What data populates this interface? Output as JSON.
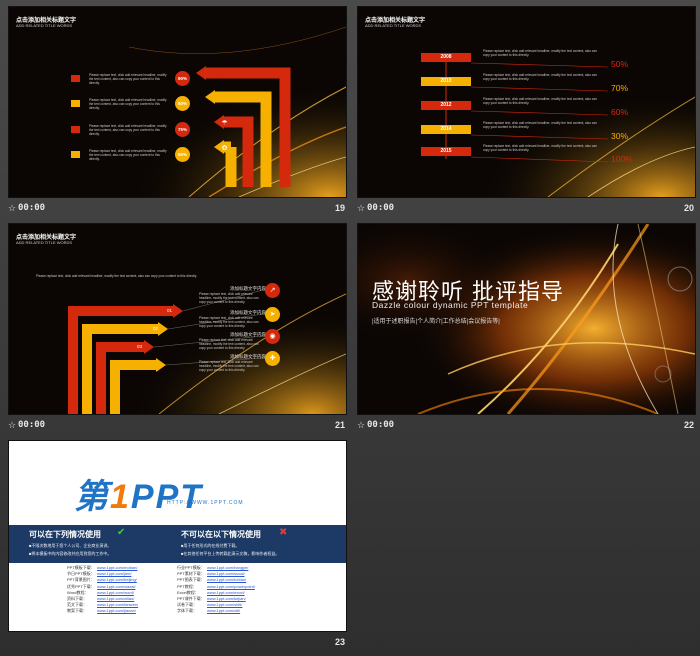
{
  "common": {
    "slide_title": "点击添加相关标题文字",
    "slide_subtitle": "ADD RELATED TITLE WORDS",
    "duration": "00:00",
    "star_icon": "☆",
    "placeholder_text": "Please replace text, click add relevant headline, modify the text content, also can copy your content to this directly."
  },
  "colors": {
    "red": "#d4290d",
    "yellow": "#f6b000"
  },
  "slides": [
    {
      "number": "19",
      "percents": [
        "90%",
        "60%",
        "75%",
        "65%"
      ]
    },
    {
      "number": "20",
      "timeline": [
        {
          "year": "2008",
          "percent": "50%"
        },
        {
          "year": "2010",
          "percent": "70%"
        },
        {
          "year": "2012",
          "percent": "60%"
        },
        {
          "year": "2014",
          "percent": "30%"
        },
        {
          "year": "2015",
          "percent": "100%"
        }
      ]
    },
    {
      "number": "21",
      "steps": [
        "01",
        "02",
        "03"
      ],
      "labels": [
        "添加标题文字内容",
        "添加标题文字内容",
        "添加标题文字内容",
        "添加标题文字内容"
      ]
    },
    {
      "number": "22",
      "title": "感谢聆听 批评指导",
      "subtitle_en": "Dazzle colour dynamic PPT template",
      "description": "|适用于述职报告|个人简介|工作总结|会议报告等|"
    },
    {
      "number": "23",
      "logo_main": "第",
      "logo_one": "1",
      "logo_rest": "PPT",
      "logo_url": "HTTP://WWW.1PPT.COM",
      "can_use_title": "可以在下列情况使用",
      "cannot_use_title": "不可以在以下情况使用",
      "can_use_items": [
        "■不限次数地用于您个人公司、企业商业演讲。",
        "■将本模板中的内容修改并应用到您的工作中。"
      ],
      "cannot_use_items": [
        "■用于任何形式的在线付费下载。",
        "■在其他任何平台上传转载此演示文稿，影响作者权益。"
      ],
      "links_left": [
        {
          "k": "PPT模板下载：",
          "v": "www.1ppt.com/moban/"
        },
        {
          "k": "节日PPT模板：",
          "v": "www.1ppt.com/jieri/"
        },
        {
          "k": "PPT背景图片：",
          "v": "www.1ppt.com/beijing/"
        },
        {
          "k": "优秀PPT下载：",
          "v": "www.1ppt.com/xiazai/"
        },
        {
          "k": "Word教程：",
          "v": "www.1ppt.com/word/"
        },
        {
          "k": "资料下载：",
          "v": "www.1ppt.com/ziliao/"
        },
        {
          "k": "范文下载：",
          "v": "www.1ppt.com/fanwen/"
        },
        {
          "k": "教案下载：",
          "v": "www.1ppt.com/jiaoan/"
        }
      ],
      "links_right": [
        {
          "k": "行业PPT模板：",
          "v": "www.1ppt.com/hangye/"
        },
        {
          "k": "PPT素材下载：",
          "v": "www.1ppt.com/sucai/"
        },
        {
          "k": "PPT图表下载：",
          "v": "www.1ppt.com/tubiao/"
        },
        {
          "k": "PPT教程：",
          "v": "www.1ppt.com/powerpoint/"
        },
        {
          "k": "Excel教程：",
          "v": "www.1ppt.com/excel/"
        },
        {
          "k": "PPT课件下载：",
          "v": "www.1ppt.com/kejian/"
        },
        {
          "k": "试卷下载：",
          "v": "www.1ppt.com/shiti/"
        },
        {
          "k": "字体下载：",
          "v": "www.1ppt.com/ziti/"
        }
      ]
    }
  ]
}
